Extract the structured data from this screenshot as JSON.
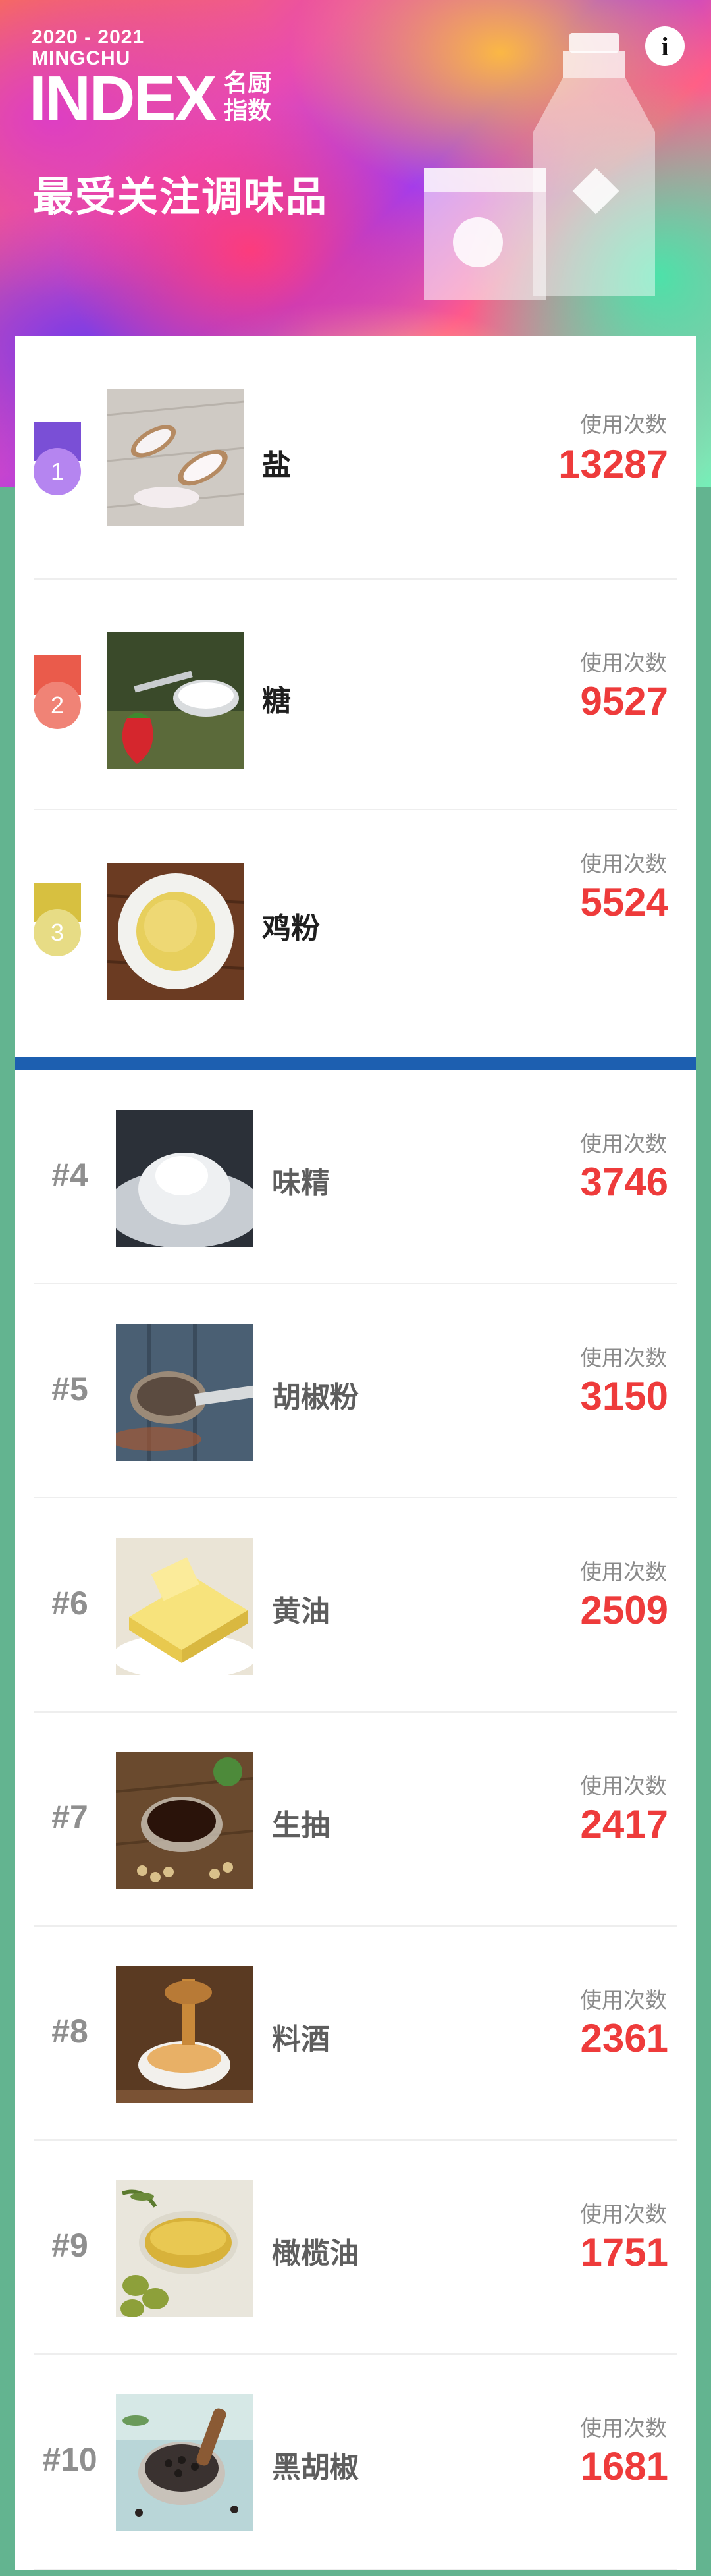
{
  "header": {
    "years": "2020 - 2021",
    "brand_sub": "MINGCHU",
    "brand_index": "INDEX",
    "brand_cn_line1": "名厨",
    "brand_cn_line2": "指数",
    "title": "最受关注调味品",
    "info_glyph": "i",
    "info_icon": "info-icon"
  },
  "colors": {
    "accent_red": "#ee3b3b",
    "divider_blue": "#1d5fb0",
    "page_green": "#63b490",
    "medal_1": "#7a4fd6",
    "medal_1_circle": "#b585f0",
    "medal_2": "#ea5b4b",
    "medal_2_circle": "#f08376",
    "medal_3": "#d7c040",
    "medal_3_circle": "#e7dc85"
  },
  "usage_label": "使用次数",
  "top3": [
    {
      "rank": "1",
      "name": "盐",
      "count": "13287",
      "image": "salt-photo"
    },
    {
      "rank": "2",
      "name": "糖",
      "count": "9527",
      "image": "sugar-photo"
    },
    {
      "rank": "3",
      "name": "鸡粉",
      "count": "5524",
      "image": "chicken-powder-photo"
    }
  ],
  "others": [
    {
      "rank": "#4",
      "name": "味精",
      "count": "3746",
      "image": "msg-photo"
    },
    {
      "rank": "#5",
      "name": "胡椒粉",
      "count": "3150",
      "image": "pepper-powder-photo"
    },
    {
      "rank": "#6",
      "name": "黄油",
      "count": "2509",
      "image": "butter-photo"
    },
    {
      "rank": "#7",
      "name": "生抽",
      "count": "2417",
      "image": "soy-sauce-photo"
    },
    {
      "rank": "#8",
      "name": "料酒",
      "count": "2361",
      "image": "cooking-wine-photo"
    },
    {
      "rank": "#9",
      "name": "橄榄油",
      "count": "1751",
      "image": "olive-oil-photo"
    },
    {
      "rank": "#10",
      "name": "黑胡椒",
      "count": "1681",
      "image": "black-pepper-photo"
    }
  ]
}
